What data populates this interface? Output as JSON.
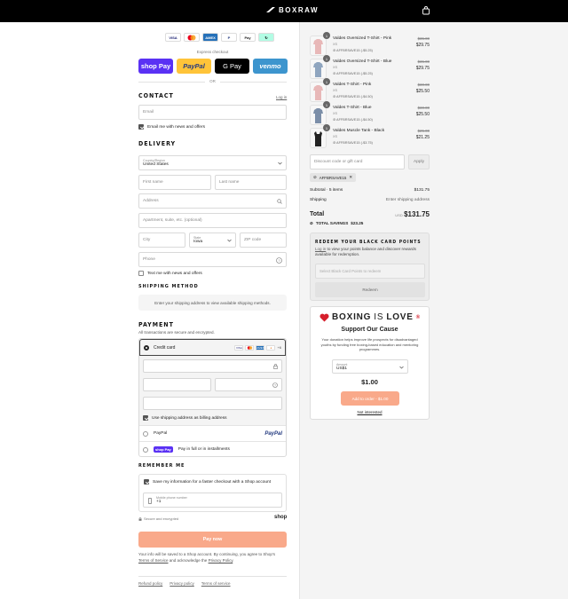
{
  "brand": "BOXRAW",
  "express": {
    "label": "Express checkout",
    "shop_pay": "shop Pay",
    "paypal": "PayPal",
    "gpay": "G Pay",
    "venmo": "venmo",
    "or": "OR"
  },
  "card_icons": [
    "VISA",
    "MC",
    "AMEX",
    "P",
    "Pay",
    "↻"
  ],
  "contact": {
    "heading": "CONTACT",
    "login": "Log in",
    "email_placeholder": "Email",
    "news_label": "Email me with news and offers"
  },
  "delivery": {
    "heading": "DELIVERY",
    "country_label": "Country/Region",
    "country_value": "United States",
    "first_name": "First name",
    "last_name": "Last name",
    "address": "Address",
    "apartment": "Apartment, suite, etc. (optional)",
    "city": "City",
    "state_label": "State",
    "state_value": "Iowa",
    "zip": "ZIP code",
    "phone": "Phone",
    "text_label": "Text me with news and offers"
  },
  "shipping_method": {
    "heading": "SHIPPING METHOD",
    "message": "Enter your shipping address to view available shipping methods."
  },
  "payment": {
    "heading": "PAYMENT",
    "subtitle": "All transactions are secure and encrypted.",
    "credit_card": "Credit card",
    "more_cards": "+6",
    "billing_label": "Use shipping address as billing address",
    "paypal": "PayPal",
    "paypal_logo": "PayPal",
    "shoppay_logo": "shop Pay",
    "shoppay_label": "Pay in full or in installments"
  },
  "remember": {
    "heading": "REMEMBER ME",
    "save_label": "Save my information for a faster checkout with a Shop account",
    "mobile_label": "Mobile phone number",
    "mobile_value": "+1",
    "secure": "Secure and encrypted",
    "shop": "shop"
  },
  "paynow": "Pay now",
  "legal": {
    "text1": "Your info will be saved to a Shop account. By continuing, you agree to Shop's ",
    "terms": "Terms of Service",
    "text2": " and acknowledge the ",
    "privacy": "Privacy Policy",
    "text3": "."
  },
  "footer": [
    "Refund policy",
    "Privacy policy",
    "Terms of service"
  ],
  "items": [
    {
      "qty": "1",
      "name": "Valdes Oversized T-Shirt - Pink",
      "size": "XS",
      "discount": "AFFBRSAVE15 (-$5.25)",
      "old": "$35.00",
      "price": "$29.75",
      "color": "#e8b8b8"
    },
    {
      "qty": "1",
      "name": "Valdes Oversized T-Shirt - Blue",
      "size": "XS",
      "discount": "AFFBRSAVE15 (-$5.25)",
      "old": "$35.00",
      "price": "$29.75",
      "color": "#8fa5bf"
    },
    {
      "qty": "1",
      "name": "Valdes T-Shirt - Pink",
      "size": "XS",
      "discount": "AFFBRSAVE15 (-$4.50)",
      "old": "$30.00",
      "price": "$25.50",
      "color": "#e8b8b8"
    },
    {
      "qty": "1",
      "name": "Valdes T-Shirt - Blue",
      "size": "XS",
      "discount": "AFFBRSAVE15 (-$4.50)",
      "old": "$30.00",
      "price": "$25.50",
      "color": "#7b8ea8"
    },
    {
      "qty": "1",
      "name": "Valdes Muscle Tank - Black",
      "size": "XS",
      "discount": "AFFBRSAVE15 (-$3.75)",
      "old": "$25.00",
      "price": "$21.25",
      "color": "#222222"
    }
  ],
  "discount": {
    "placeholder": "Discount code or gift card",
    "apply": "Apply",
    "code": "AFFBRSAVE15"
  },
  "summary": {
    "subtotal_label": "Subtotal · 5 items",
    "subtotal": "$131.75",
    "shipping_label": "Shipping",
    "shipping": "Enter shipping address",
    "total_label": "Total",
    "currency": "USD",
    "total": "$131.75",
    "savings_label": "TOTAL SAVINGS",
    "savings": "$23.25"
  },
  "black_card": {
    "heading": "REDEEM YOUR BLACK CARD POINTS",
    "login": "Log in",
    "text": " to view your points balance and discover rewards available for redemption.",
    "select": "Select Black Card Points to redeem",
    "redeem": "Redeem"
  },
  "donation": {
    "logo1": "BOXING",
    "logo2": "IS",
    "logo3": "LOVE",
    "title": "Support Our Cause",
    "text": "Your donation helps improve life prospects for disadvantaged youths by funding free boxing-based education and mentoring programmes.",
    "amount_label": "Amount",
    "amount_value": "US$1",
    "amount": "$1.00",
    "add": "Add to order - $1.00",
    "not_interested": "Not interested"
  }
}
